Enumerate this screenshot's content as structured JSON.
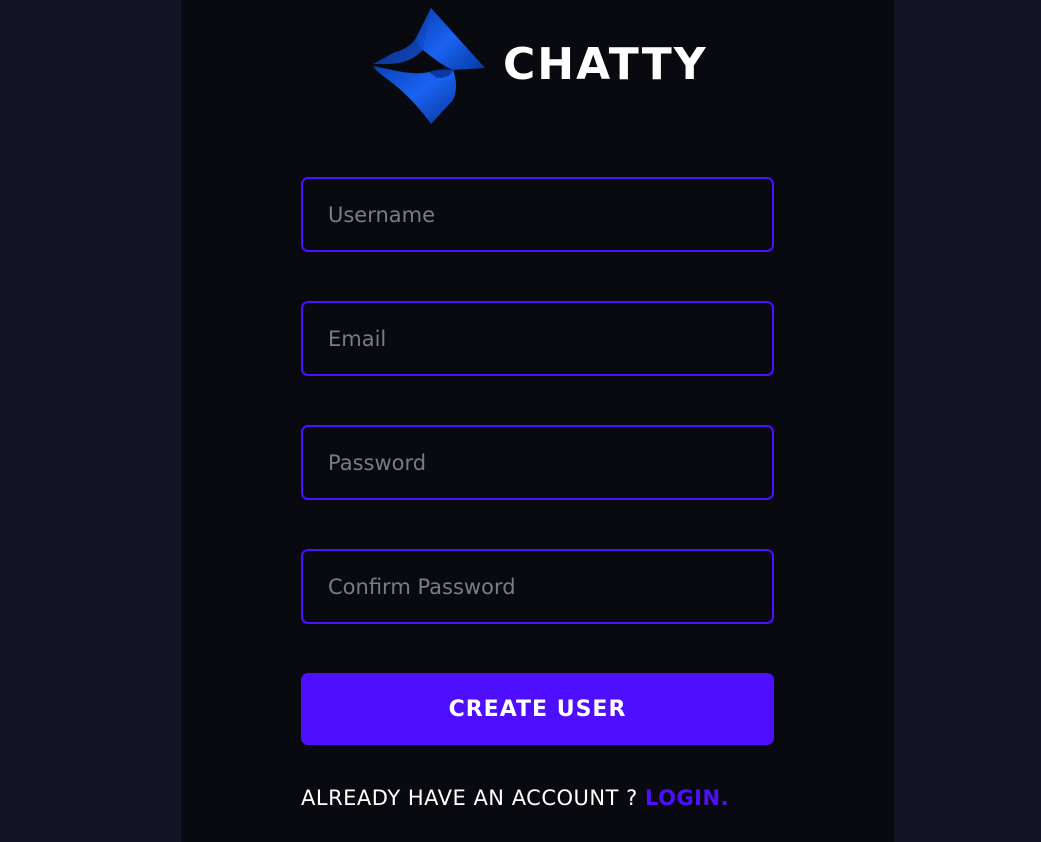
{
  "app": {
    "name": "CHATTY",
    "logo_icon": "chatty-logo-icon"
  },
  "form": {
    "username_placeholder": "Username",
    "email_placeholder": "Email",
    "password_placeholder": "Password",
    "confirm_password_placeholder": "Confirm Password",
    "submit_label": "CREATE USER"
  },
  "footer": {
    "prompt": "ALREADY HAVE AN ACCOUNT ? ",
    "login_label": "LOGIN."
  },
  "colors": {
    "page_background": "#131324",
    "panel_background": "#090910",
    "accent": "#4e0eff",
    "placeholder_text": "#7b7b84",
    "logo_blue": "#0b4fd6"
  }
}
